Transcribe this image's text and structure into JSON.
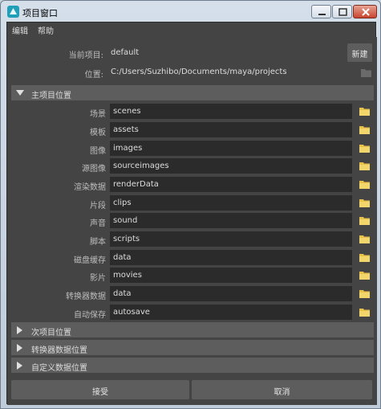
{
  "window": {
    "title": "项目窗口"
  },
  "menu": [
    {
      "label": "编辑"
    },
    {
      "label": "帮助"
    }
  ],
  "project": {
    "current_label": "当前项目:",
    "current_value": "default",
    "new_button": "新建",
    "location_label": "位置:",
    "location_value": "C:/Users/Suzhibo/Documents/maya/projects"
  },
  "main_section": {
    "title": "主项目位置",
    "rows": [
      {
        "label": "场景",
        "value": "scenes"
      },
      {
        "label": "模板",
        "value": "assets"
      },
      {
        "label": "图像",
        "value": "images"
      },
      {
        "label": "源图像",
        "value": "sourceimages"
      },
      {
        "label": "渲染数据",
        "value": "renderData"
      },
      {
        "label": "片段",
        "value": "clips"
      },
      {
        "label": "声音",
        "value": "sound"
      },
      {
        "label": "脚本",
        "value": "scripts"
      },
      {
        "label": "磁盘缓存",
        "value": "data"
      },
      {
        "label": "影片",
        "value": "movies"
      },
      {
        "label": "转换器数据",
        "value": "data"
      },
      {
        "label": "自动保存",
        "value": "autosave"
      }
    ]
  },
  "collapsed_sections": [
    {
      "title": "次项目位置"
    },
    {
      "title": "转换器数据位置"
    },
    {
      "title": "自定义数据位置"
    }
  ],
  "buttons": {
    "accept": "接受",
    "cancel": "取消"
  },
  "colors": {
    "panel_bg": "#444444",
    "field_bg": "#2b2b2b",
    "section_bg": "#5d5d5d",
    "folder": "#e8c14a"
  }
}
